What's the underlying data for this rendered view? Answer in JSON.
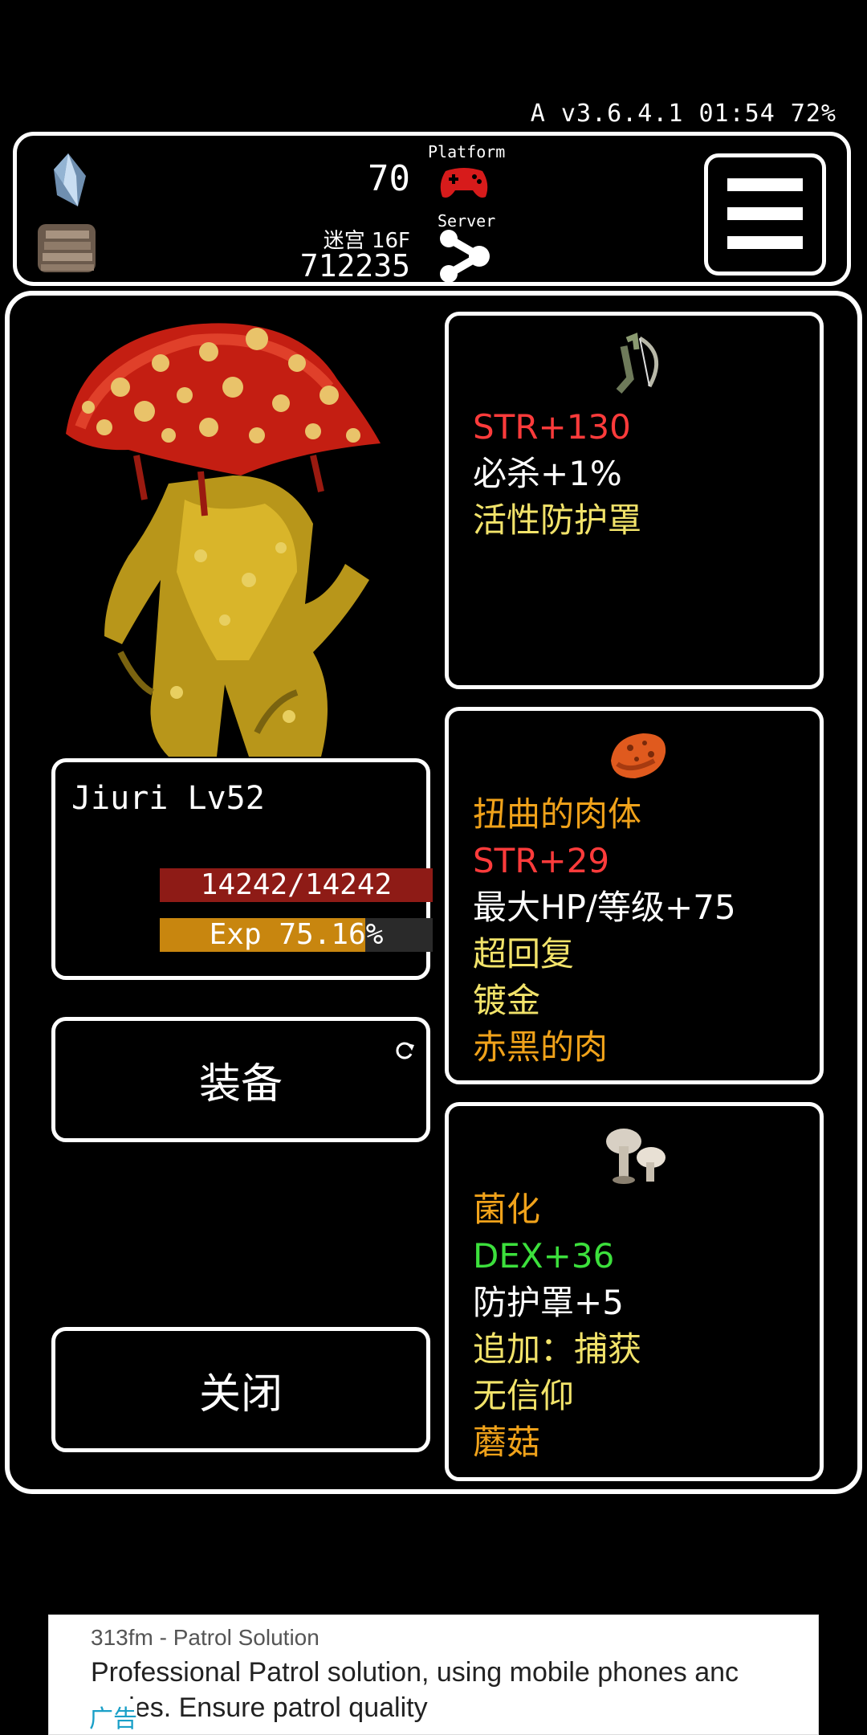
{
  "status_bar": {
    "text": "A v3.6.4.1 01:54 72%"
  },
  "top_bar": {
    "currency_value": "70",
    "platform_label": "Platform",
    "server_label": "Server",
    "dungeon_label": "迷宫 16F",
    "dungeon_value": "712235"
  },
  "monster": {
    "name_level": "Jiuri Lv52",
    "hp_text": "14242/14242",
    "hp_fraction": 1.0,
    "exp_text": "Exp 75.16%",
    "exp_fraction": 0.7516
  },
  "buttons": {
    "equip": "装备",
    "close": "关闭"
  },
  "items": [
    {
      "icon": "bow-icon",
      "lines": [
        {
          "text": "STR+130",
          "color": "#ff3b3b"
        },
        {
          "text": "必杀+1%",
          "color": "#ffffff"
        },
        {
          "text": "活性防护罩",
          "color": "#f2e36a"
        }
      ]
    },
    {
      "icon": "meat-icon",
      "lines": [
        {
          "text": "扭曲的肉体",
          "color": "#f0a21a"
        },
        {
          "text": "STR+29",
          "color": "#ff3b3b"
        },
        {
          "text": "最大HP/等级+75",
          "color": "#ffffff"
        },
        {
          "text": "超回复",
          "color": "#f2e36a"
        },
        {
          "text": "镀金",
          "color": "#f2e36a"
        },
        {
          "text": "赤黑的肉",
          "color": "#f0a21a"
        }
      ]
    },
    {
      "icon": "mushroom-icon",
      "lines": [
        {
          "text": "菌化",
          "color": "#f0a21a"
        },
        {
          "text": "DEX+36",
          "color": "#3ce03c"
        },
        {
          "text": "防护罩+5",
          "color": "#ffffff"
        },
        {
          "text": "追加：捕获",
          "color": "#f2e36a"
        },
        {
          "text": "无信仰",
          "color": "#f2e36a"
        },
        {
          "text": "蘑菇",
          "color": "#f0a21a"
        }
      ]
    }
  ],
  "ad": {
    "source": "313fm - Patrol Solution",
    "text_line1": "Professional Patrol solution, using mobile phones anc",
    "text_line2": "codes. Ensure patrol quality",
    "badge": "广告"
  }
}
